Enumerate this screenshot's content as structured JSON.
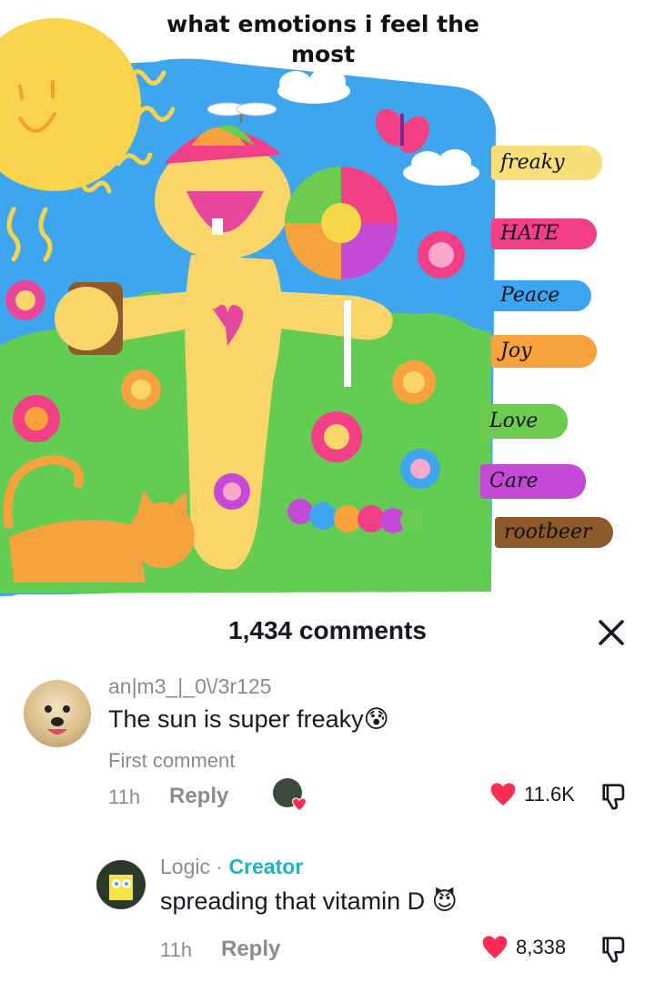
{
  "post": {
    "title": "what emotions i feel the most",
    "emotion_tags": [
      {
        "label": "freaky",
        "color": "#f8df7a"
      },
      {
        "label": "HATE",
        "color": "#f23f86"
      },
      {
        "label": "Peace",
        "color": "#3ca5f2"
      },
      {
        "label": "Joy",
        "color": "#f7a23c"
      },
      {
        "label": "Love",
        "color": "#6ccc4f"
      },
      {
        "label": "Care",
        "color": "#c44ad6"
      },
      {
        "label": "rootbeer",
        "color": "#8f5a2b"
      }
    ]
  },
  "sheet": {
    "count_label": "1,434 comments"
  },
  "comments": [
    {
      "username": "an|m3_|_0\\/3r125",
      "text": "The sun is super freaky😰",
      "tag": "First comment",
      "time": "11h",
      "reply_label": "Reply",
      "likes": "11.6K",
      "liked_by_creator": true
    },
    {
      "username": "Logic",
      "separator": " · ",
      "badge": "Creator",
      "text": "spreading that vitamin D 😈",
      "time": "11h",
      "reply_label": "Reply",
      "likes": "8,338"
    }
  ],
  "colors": {
    "heart": "#fe2c55",
    "creator_badge": "#20b0c8",
    "sky": "#3ea6ee",
    "grass": "#63cc52",
    "sun": "#f9d34d"
  }
}
